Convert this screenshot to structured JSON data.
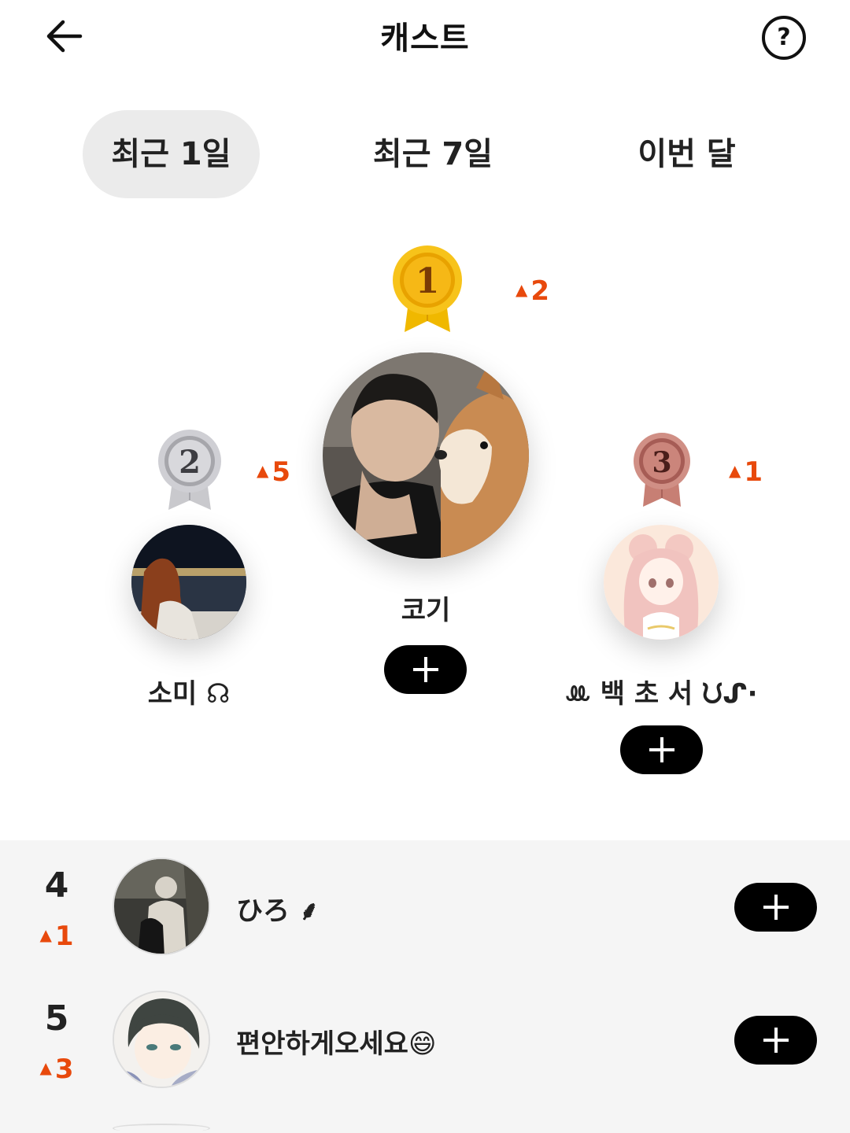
{
  "header": {
    "title": "캐스트",
    "back_icon": "arrow-left-icon",
    "help_label": "?"
  },
  "tabs": [
    {
      "label": "최근 1일",
      "active": true
    },
    {
      "label": "최근 7일",
      "active": false
    },
    {
      "label": "이번 달",
      "active": false
    }
  ],
  "podium": {
    "first": {
      "medal": "1",
      "change": "2",
      "name": "코기"
    },
    "second": {
      "medal": "2",
      "change": "5",
      "name": "소미 ☊"
    },
    "third": {
      "medal": "3",
      "change": "1",
      "name": "ꔛ 백 초 서 ᙀᔑ·"
    }
  },
  "list": [
    {
      "rank": "4",
      "change": "1",
      "name": "ひろ ⸙"
    },
    {
      "rank": "5",
      "change": "3",
      "name": "편안하게오세요😄"
    }
  ],
  "colors": {
    "accent": "#e8490c",
    "gold": "#f2b705",
    "silver": "#bfbfc4",
    "bronze": "#c8756a"
  }
}
